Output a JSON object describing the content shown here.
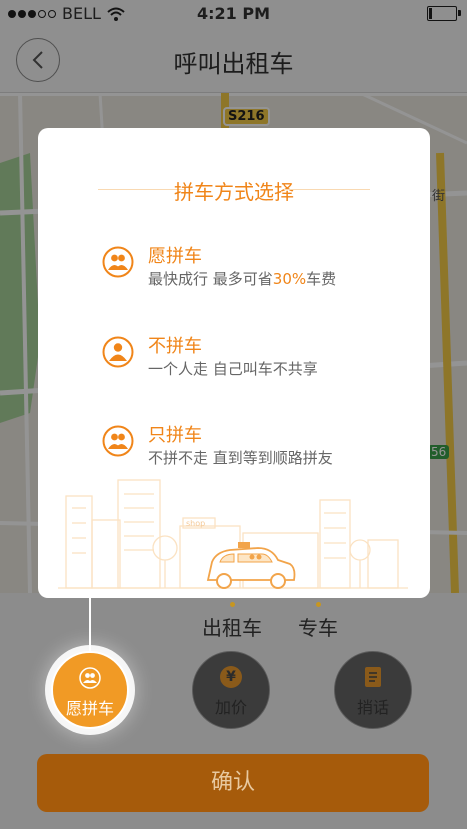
{
  "status": {
    "carrier": "BELL",
    "time": "4:21 PM",
    "battery_level": 0.12
  },
  "header": {
    "title": "呼叫出租车"
  },
  "map": {
    "road_badge": "S216",
    "partial_road": "56",
    "partial_label": "街"
  },
  "vehicle_tabs": [
    {
      "label": "出租车"
    },
    {
      "label": "专车"
    }
  ],
  "options": [
    {
      "label": "愿拼车",
      "icon": "carpool-icon",
      "active": true
    },
    {
      "label": "加价",
      "icon": "yen-icon",
      "symbol": "¥"
    },
    {
      "label": "捎话",
      "icon": "message-icon"
    }
  ],
  "confirm": {
    "label": "确认"
  },
  "modal": {
    "title": "拼车方式选择",
    "items": [
      {
        "name": "愿拼车",
        "desc_pre": "最快成行  最多可省",
        "highlight": "30%",
        "desc_post": "车费",
        "icon": "two-people-icon"
      },
      {
        "name": "不拼车",
        "desc_pre": "一个人走  自己叫车不共享",
        "highlight": "",
        "desc_post": "",
        "icon": "single-person-icon"
      },
      {
        "name": "只拼车",
        "desc_pre": "不拼不走  直到等到顺路拼友",
        "highlight": "",
        "desc_post": "",
        "icon": "two-people-icon"
      }
    ],
    "illustration": {
      "shop_sign": "shop"
    }
  },
  "colors": {
    "accent": "#f08519",
    "confirm_bg": "#a65b0b",
    "map_bg": "#ece9e1",
    "park": "#a8d39a"
  }
}
